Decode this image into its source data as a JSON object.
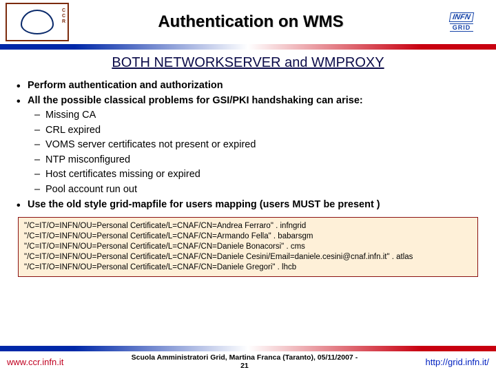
{
  "header": {
    "title": "Authentication on WMS",
    "logo_left_label": "CCR",
    "logo_right_top": "INFN",
    "logo_right_bottom": "GRID"
  },
  "subtitle": "BOTH NETWORKSERVER and WMPROXY",
  "bullets": {
    "b1": "Perform authentication and authorization",
    "b2": "All the possible classical problems for GSI/PKI handshaking can arise:",
    "s1": "Missing CA",
    "s2": "CRL expired",
    "s3": "VOMS server certificates not present or expired",
    "s4": "NTP misconfigured",
    "s5": "Host certificates missing or expired",
    "s6": "Pool account run out",
    "b3": "Use the old style grid-mapfile for users mapping (users MUST be present )"
  },
  "code": {
    "l1": "\"/C=IT/O=INFN/OU=Personal Certificate/L=CNAF/CN=Andrea Ferraro\" . infngrid",
    "l2": "\"/C=IT/O=INFN/OU=Personal Certificate/L=CNAF/CN=Armando Fella\" . babarsgm",
    "l3": "\"/C=IT/O=INFN/OU=Personal Certificate/L=CNAF/CN=Daniele Bonacorsi\" . cms",
    "l4": "\"/C=IT/O=INFN/OU=Personal Certificate/L=CNAF/CN=Daniele Cesini/Email=daniele.cesini@cnaf.infn.it\" . atlas",
    "l5": "\"/C=IT/O=INFN/OU=Personal Certificate/L=CNAF/CN=Daniele Gregori\" . lhcb"
  },
  "footer": {
    "left": "www.ccr.infn.it",
    "center_line1": "Scuola Amministratori Grid, Martina Franca (Taranto), 05/11/2007 -",
    "center_line2": "21",
    "right": "http://grid.infn.it/"
  }
}
